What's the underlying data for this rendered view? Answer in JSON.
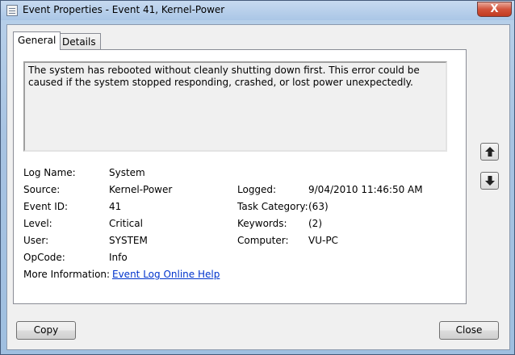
{
  "window": {
    "title": "Event Properties - Event 41, Kernel-Power",
    "close_glyph": "X"
  },
  "tabs": [
    {
      "label": "General",
      "selected": true
    },
    {
      "label": "Details",
      "selected": false
    }
  ],
  "general": {
    "description": "The system has rebooted without cleanly shutting down first. This error could be caused if the system stopped responding, crashed, or lost power unexpectedly.",
    "left_fields": [
      {
        "label": "Log Name:",
        "value": "System"
      },
      {
        "label": "Source:",
        "value": "Kernel-Power"
      },
      {
        "label": "Event ID:",
        "value": "41"
      },
      {
        "label": "Level:",
        "value": "Critical"
      },
      {
        "label": "User:",
        "value": "SYSTEM"
      },
      {
        "label": "OpCode:",
        "value": "Info"
      },
      {
        "label": "More Information:",
        "value": "Event Log Online Help"
      }
    ],
    "right_fields": [
      {
        "label": "Logged:",
        "value": "9/04/2010 11:46:50 AM"
      },
      {
        "label": "Task Category:",
        "value": "(63)"
      },
      {
        "label": "Keywords:",
        "value": "(2)"
      },
      {
        "label": "Computer:",
        "value": "VU-PC"
      }
    ]
  },
  "buttons": {
    "copy": "Copy",
    "close": "Close"
  }
}
